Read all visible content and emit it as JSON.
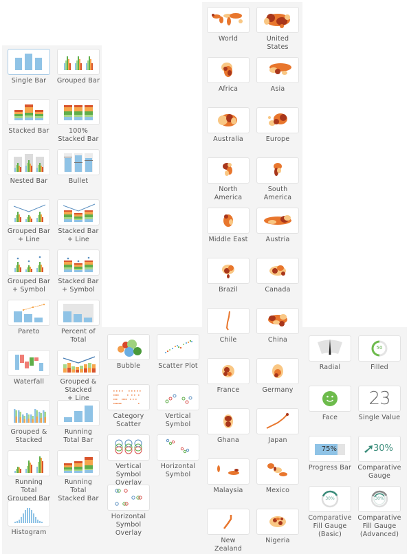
{
  "colors": {
    "blue": "#8fc3e6",
    "green": "#5fae4a",
    "lightgreen": "#a8d88a",
    "orange": "#f6a64c",
    "darkorange": "#e05a1f",
    "red": "#d9542c",
    "gray": "#dcdcdc",
    "mapdark": "#a8361b",
    "mapmid": "#e8762d",
    "maplight": "#f9c784",
    "facegreen": "#6dbb4c",
    "teal": "#3a8c7a"
  },
  "bar_panel": {
    "selected": "Single Bar",
    "items": [
      {
        "id": "single-bar",
        "label": "Single Bar"
      },
      {
        "id": "grouped-bar",
        "label": "Grouped Bar"
      },
      {
        "id": "stacked-bar",
        "label": "Stacked Bar"
      },
      {
        "id": "100-stacked-bar",
        "label": "100%\nStacked Bar"
      },
      {
        "id": "nested-bar",
        "label": "Nested Bar"
      },
      {
        "id": "bullet",
        "label": "Bullet"
      },
      {
        "id": "grouped-bar-line",
        "label": "Grouped Bar\n+ Line"
      },
      {
        "id": "stacked-bar-line",
        "label": "Stacked Bar\n+ Line"
      },
      {
        "id": "grouped-bar-symbol",
        "label": "Grouped Bar\n+ Symbol"
      },
      {
        "id": "stacked-bar-symbol",
        "label": "Stacked Bar\n+ Symbol"
      },
      {
        "id": "pareto",
        "label": "Pareto"
      },
      {
        "id": "percent-of-total",
        "label": "Percent of\nTotal"
      },
      {
        "id": "waterfall",
        "label": "Waterfall"
      },
      {
        "id": "grouped-stacked-line",
        "label": "Grouped &\nStacked\n+ Line"
      },
      {
        "id": "grouped-stacked",
        "label": "Grouped &\nStacked"
      },
      {
        "id": "running-total-bar",
        "label": "Running\nTotal Bar"
      },
      {
        "id": "running-total-grouped-bar",
        "label": "Running\nTotal\nGrouped Bar"
      },
      {
        "id": "running-total-stacked-bar",
        "label": "Running\nTotal\nStacked Bar"
      },
      {
        "id": "histogram",
        "label": "Histogram"
      }
    ]
  },
  "scatter_panel": {
    "items": [
      {
        "id": "bubble",
        "label": "Bubble"
      },
      {
        "id": "scatter-plot",
        "label": "Scatter Plot"
      },
      {
        "id": "category-scatter",
        "label": "Category\nScatter"
      },
      {
        "id": "vertical-symbol",
        "label": "Vertical\nSymbol"
      },
      {
        "id": "vertical-symbol-overlay",
        "label": "Vertical\nSymbol\nOverlay"
      },
      {
        "id": "horizontal-symbol",
        "label": "Horizontal\nSymbol"
      },
      {
        "id": "horizontal-symbol-overlay",
        "label": "Horizontal\nSymbol\nOverlay"
      }
    ]
  },
  "map_panel": {
    "items": [
      {
        "id": "world",
        "label": "World"
      },
      {
        "id": "united-states",
        "label": "United\nStates"
      },
      {
        "id": "africa",
        "label": "Africa"
      },
      {
        "id": "asia",
        "label": "Asia"
      },
      {
        "id": "australia",
        "label": "Australia"
      },
      {
        "id": "europe",
        "label": "Europe"
      },
      {
        "id": "north-america",
        "label": "North\nAmerica"
      },
      {
        "id": "south-america",
        "label": "South\nAmerica"
      },
      {
        "id": "middle-east",
        "label": "Middle East"
      },
      {
        "id": "austria",
        "label": "Austria"
      },
      {
        "id": "brazil",
        "label": "Brazil"
      },
      {
        "id": "canada",
        "label": "Canada"
      },
      {
        "id": "chile",
        "label": "Chile"
      },
      {
        "id": "china",
        "label": "China"
      },
      {
        "id": "france",
        "label": "France"
      },
      {
        "id": "germany",
        "label": "Germany"
      },
      {
        "id": "ghana",
        "label": "Ghana"
      },
      {
        "id": "japan",
        "label": "Japan"
      },
      {
        "id": "malaysia",
        "label": "Malaysia"
      },
      {
        "id": "mexico",
        "label": "Mexico"
      },
      {
        "id": "new-zealand",
        "label": "New\nZealand"
      },
      {
        "id": "nigeria",
        "label": "Nigeria"
      }
    ]
  },
  "gauge_panel": {
    "items": [
      {
        "id": "radial",
        "label": "Radial"
      },
      {
        "id": "filled",
        "label": "Filled",
        "value_text": "50"
      },
      {
        "id": "face",
        "label": "Face"
      },
      {
        "id": "single-value",
        "label": "Single Value",
        "value_text": "23"
      },
      {
        "id": "progress-bar",
        "label": "Progress Bar",
        "value_text": "75%",
        "fraction": 0.75
      },
      {
        "id": "comparative-gauge",
        "label": "Comparative\nGauge",
        "value_text": "30%"
      },
      {
        "id": "comparative-fill-gauge-basic",
        "label": "Comparative\nFill Gauge\n(Basic)",
        "value_text": "30%"
      },
      {
        "id": "comparative-fill-gauge-advanced",
        "label": "Comparative\nFill Gauge\n(Advanced)",
        "value_text": "30%"
      }
    ]
  }
}
